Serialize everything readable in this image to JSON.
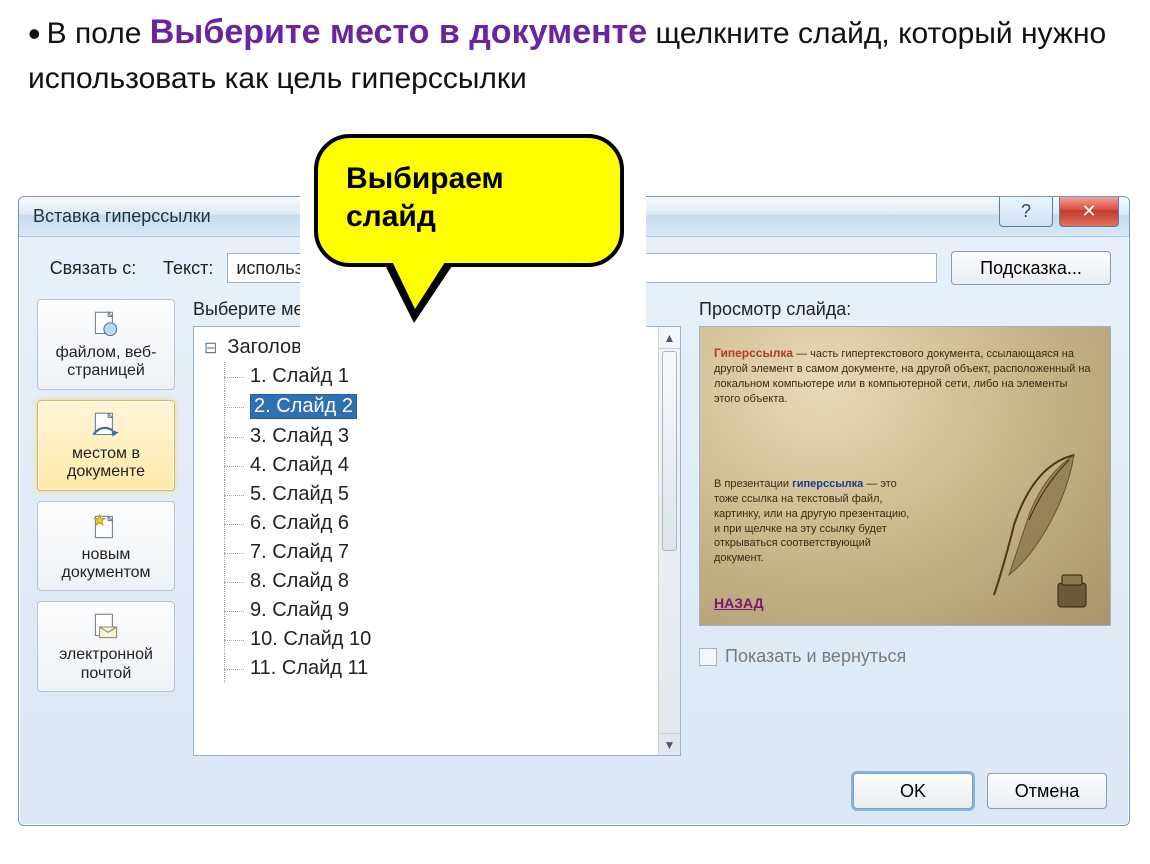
{
  "instruction": {
    "prefix": "В поле ",
    "highlight": "Выберите место в документе",
    "suffix": " щелкните слайд, который нужно использовать как цель гиперссылки"
  },
  "callout": {
    "line1": "Выбираем",
    "line2": "слайд"
  },
  "dialog": {
    "title": "Вставка гиперссылки",
    "help": "?",
    "close": "✕",
    "link_with_label": "Связать с:",
    "text_label": "Текст:",
    "text_value": "использовать как гип",
    "hint_button": "Подсказка...",
    "sidebar": {
      "web": "файлом, веб-\nстраницей",
      "place": "местом в\nдокументе",
      "newdoc": "новым\nдокументом",
      "email": "электронной\nпочтой"
    },
    "tree_label": "Выберите место в документе:",
    "tree": {
      "root": "Заголовки слайдов",
      "items": [
        "1. Слайд 1",
        "2. Слайд 2",
        "3. Слайд 3",
        "4. Слайд 4",
        "5. Слайд 5",
        "6. Слайд 6",
        "7. Слайд 7",
        "8. Слайд 8",
        "9. Слайд 9",
        "10. Слайд 10",
        "11. Слайд 11"
      ],
      "selected_index": 1
    },
    "preview_label": "Просмотр слайда:",
    "preview": {
      "term": "Гиперссылка",
      "def": " — часть гипертекстового документа, ссылающаяся на другой элемент в самом документе, на другой объект, расположенный на локальном компьютере или в компьютерной сети, либо на элементы этого объекта.",
      "p2a": "В презентации ",
      "p2b": "гиперссылка",
      "p2c": " — это тоже ссылка на текстовый файл, картинку, или на другую презентацию, и при щелчке на эту ссылку будет открываться соответствующий документ.",
      "back": "НАЗАД"
    },
    "show_return": "Показать и вернуться",
    "ok": "OK",
    "cancel": "Отмена"
  }
}
